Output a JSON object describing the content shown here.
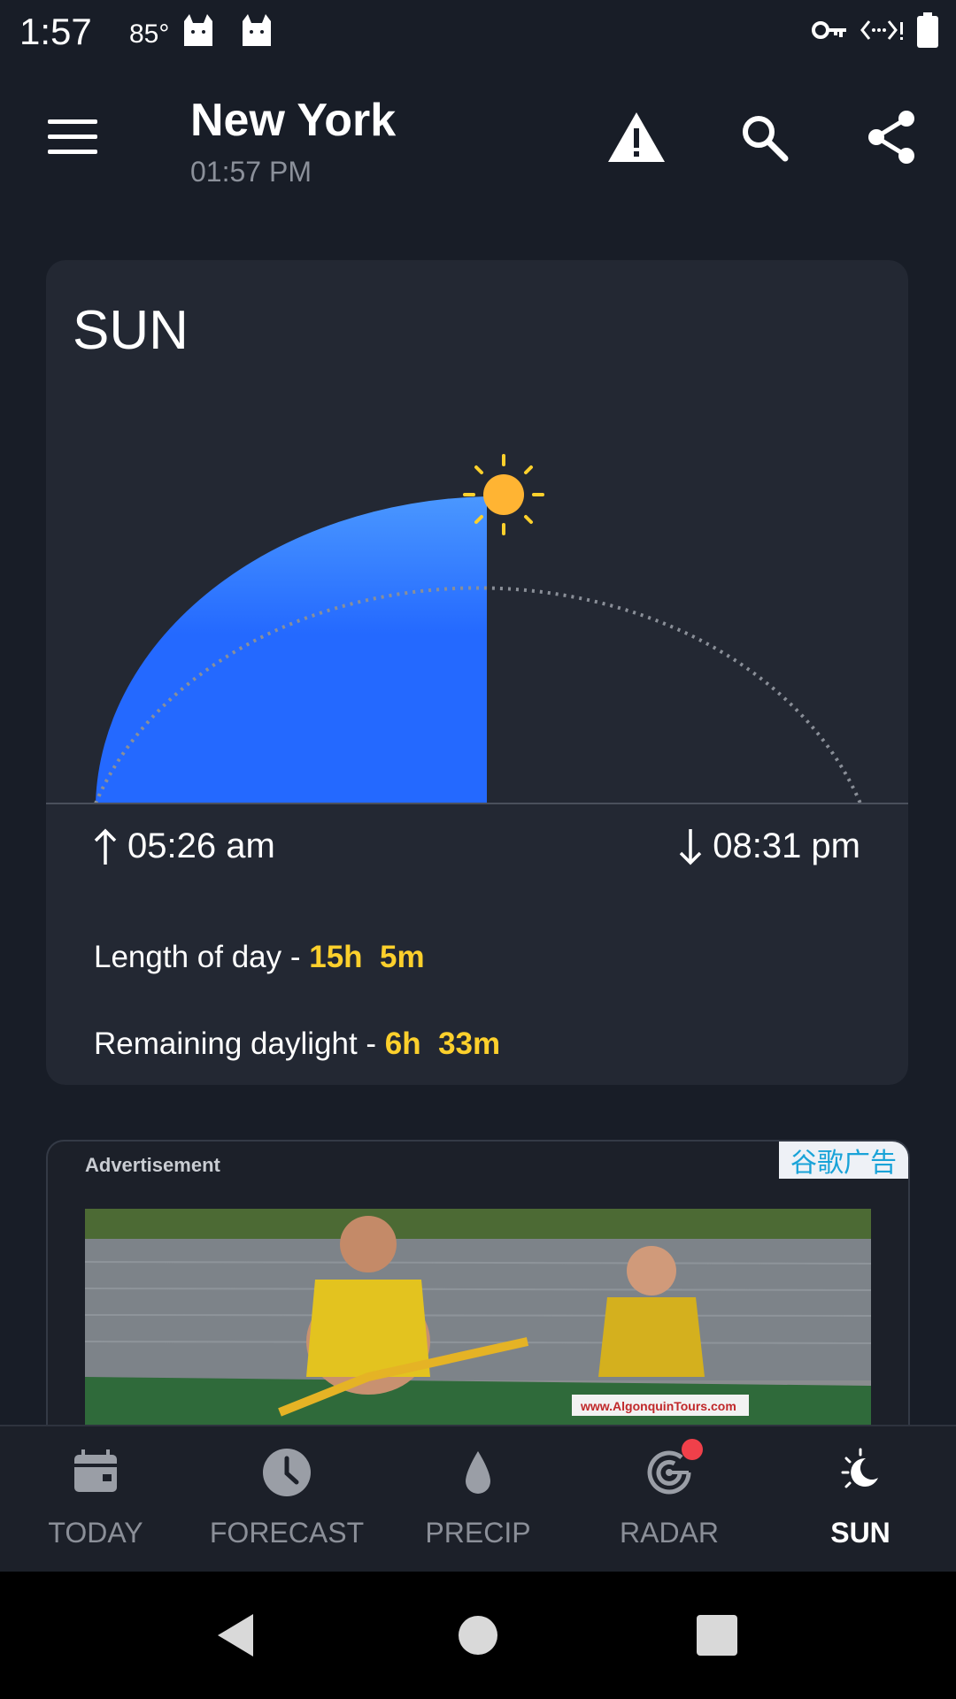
{
  "status_bar": {
    "time": "1:57",
    "temperature": "85°",
    "icons": [
      "cat-notification-icon",
      "cat-notification-icon",
      "vpn-key-icon",
      "data-saver-icon",
      "battery-icon"
    ]
  },
  "header": {
    "city": "New York",
    "local_time": "01:57 PM",
    "actions": [
      "alert-icon",
      "search-icon",
      "share-icon"
    ]
  },
  "sun_card": {
    "title": "SUN",
    "sunrise": "05:26 am",
    "sunset": "08:31 pm",
    "length_label": "Length of day - ",
    "length_hours": "15h",
    "length_minutes": "5m",
    "remaining_label": "Remaining daylight - ",
    "remaining_hours": "6h",
    "remaining_minutes": "33m",
    "daylight_elapsed_fraction": 0.5,
    "colors": {
      "arc_fill": "#2469ff",
      "highlight": "#fdd02c",
      "sun": "#ffb433"
    }
  },
  "ad": {
    "label": "Advertisement",
    "badge": "谷歌广告",
    "image_url_text": "www.AlgonquinTours.com"
  },
  "bottom_nav": {
    "items": [
      {
        "label": "TODAY",
        "icon": "calendar-icon",
        "active": false
      },
      {
        "label": "FORECAST",
        "icon": "clock-icon",
        "active": false
      },
      {
        "label": "PRECIP",
        "icon": "raindrop-icon",
        "active": false
      },
      {
        "label": "RADAR",
        "icon": "radar-icon",
        "active": false
      },
      {
        "label": "SUN",
        "icon": "sun-moon-icon",
        "active": true
      }
    ]
  },
  "system_nav": [
    "back-icon",
    "home-icon",
    "recents-icon"
  ]
}
